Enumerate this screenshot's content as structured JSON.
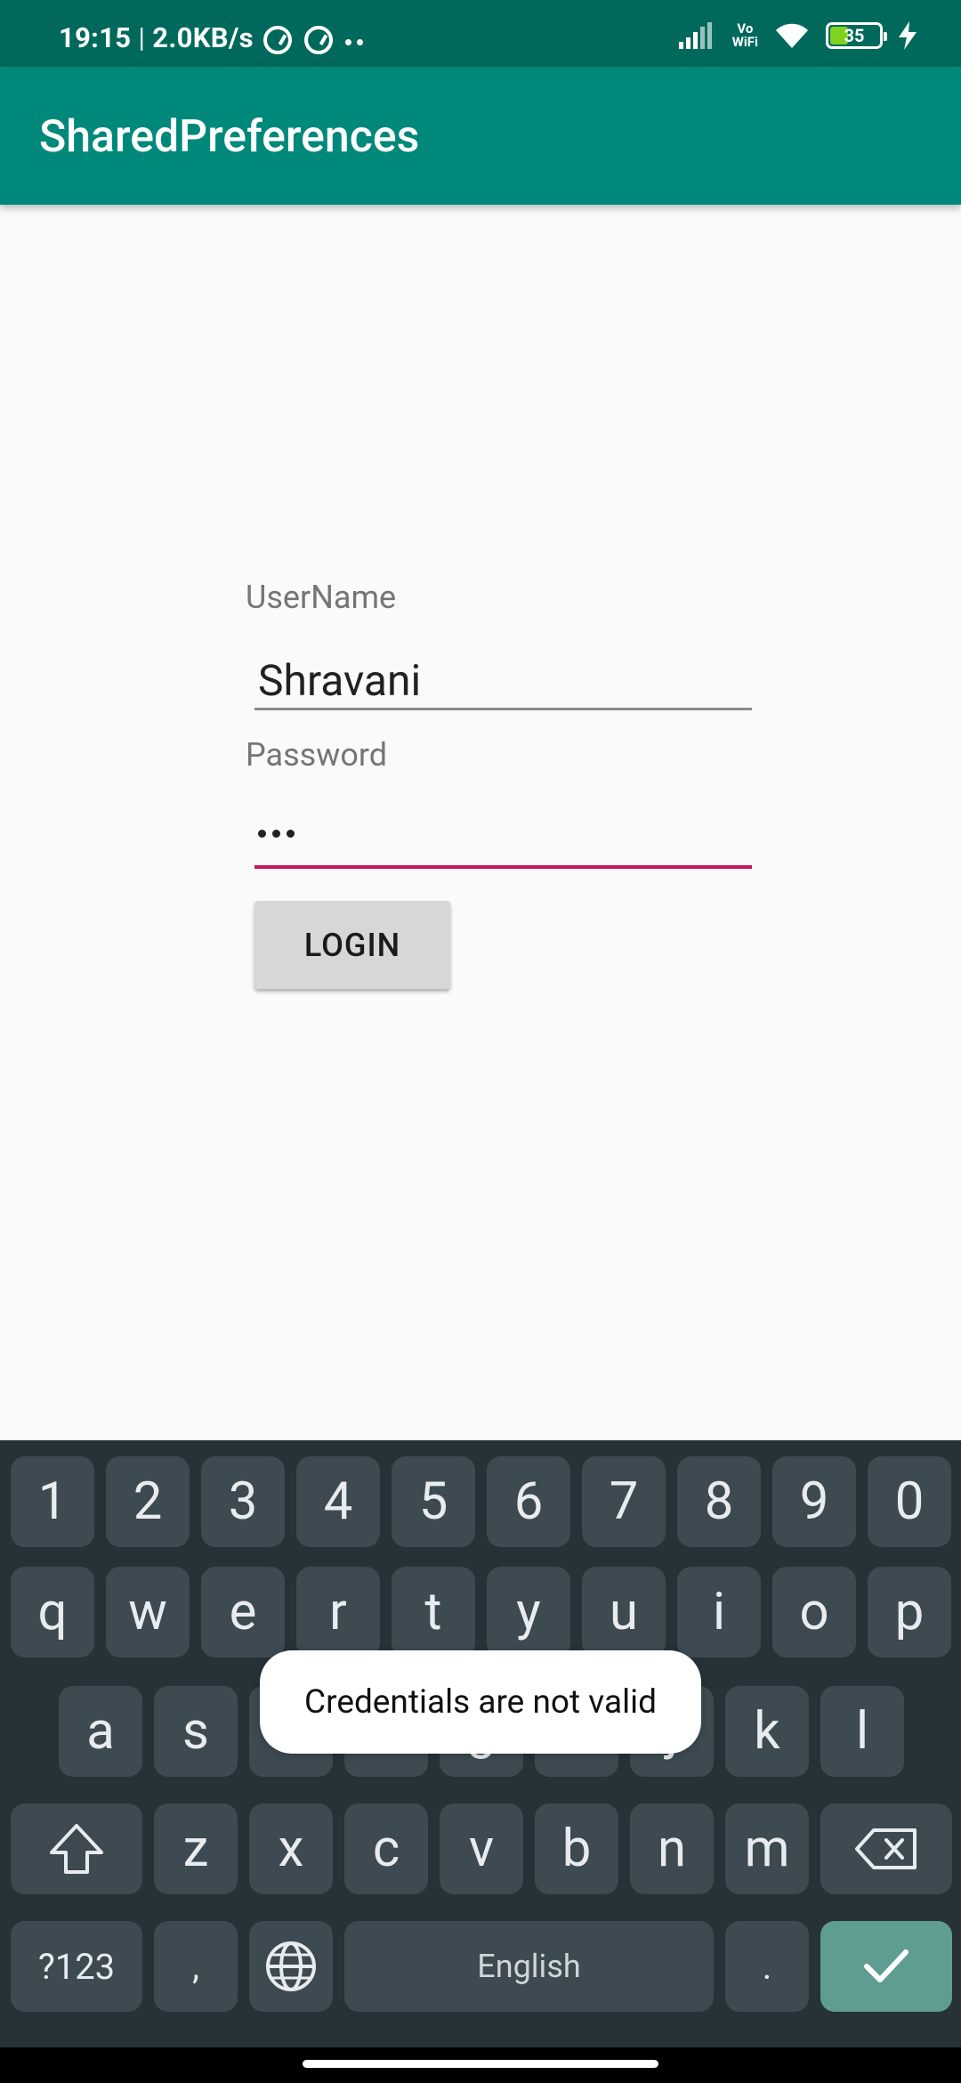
{
  "status_bar": {
    "time": "19:15",
    "separator": "|",
    "speed": "2.0KB/s",
    "battery_level": "35",
    "vowifi_label": "Vo\nWiFi"
  },
  "app_bar": {
    "title": "SharedPreferences"
  },
  "form": {
    "username_label": "UserName",
    "username_value": "Shravani",
    "password_label": "Password",
    "password_length": 3,
    "login_label": "LOGIN"
  },
  "toast": {
    "message": "Credentials are not valid"
  },
  "keyboard": {
    "row_numbers": [
      "1",
      "2",
      "3",
      "4",
      "5",
      "6",
      "7",
      "8",
      "9",
      "0"
    ],
    "row_top": [
      "q",
      "w",
      "e",
      "r",
      "t",
      "y",
      "u",
      "i",
      "o",
      "p"
    ],
    "row_middle": [
      "a",
      "s",
      "d",
      "f",
      "g",
      "h",
      "j",
      "k",
      "l"
    ],
    "row_bottom": [
      "z",
      "x",
      "c",
      "v",
      "b",
      "n",
      "m"
    ],
    "symbols_label": "?123",
    "comma_label": ",",
    "space_label": "English",
    "period_label": "."
  },
  "colors": {
    "status_bar": "#00695c",
    "app_bar": "#00897b",
    "focus_accent": "#c2185b",
    "keyboard_bg": "#263238",
    "key_bg": "#3d4a51",
    "enter_key": "#5f9c92"
  }
}
